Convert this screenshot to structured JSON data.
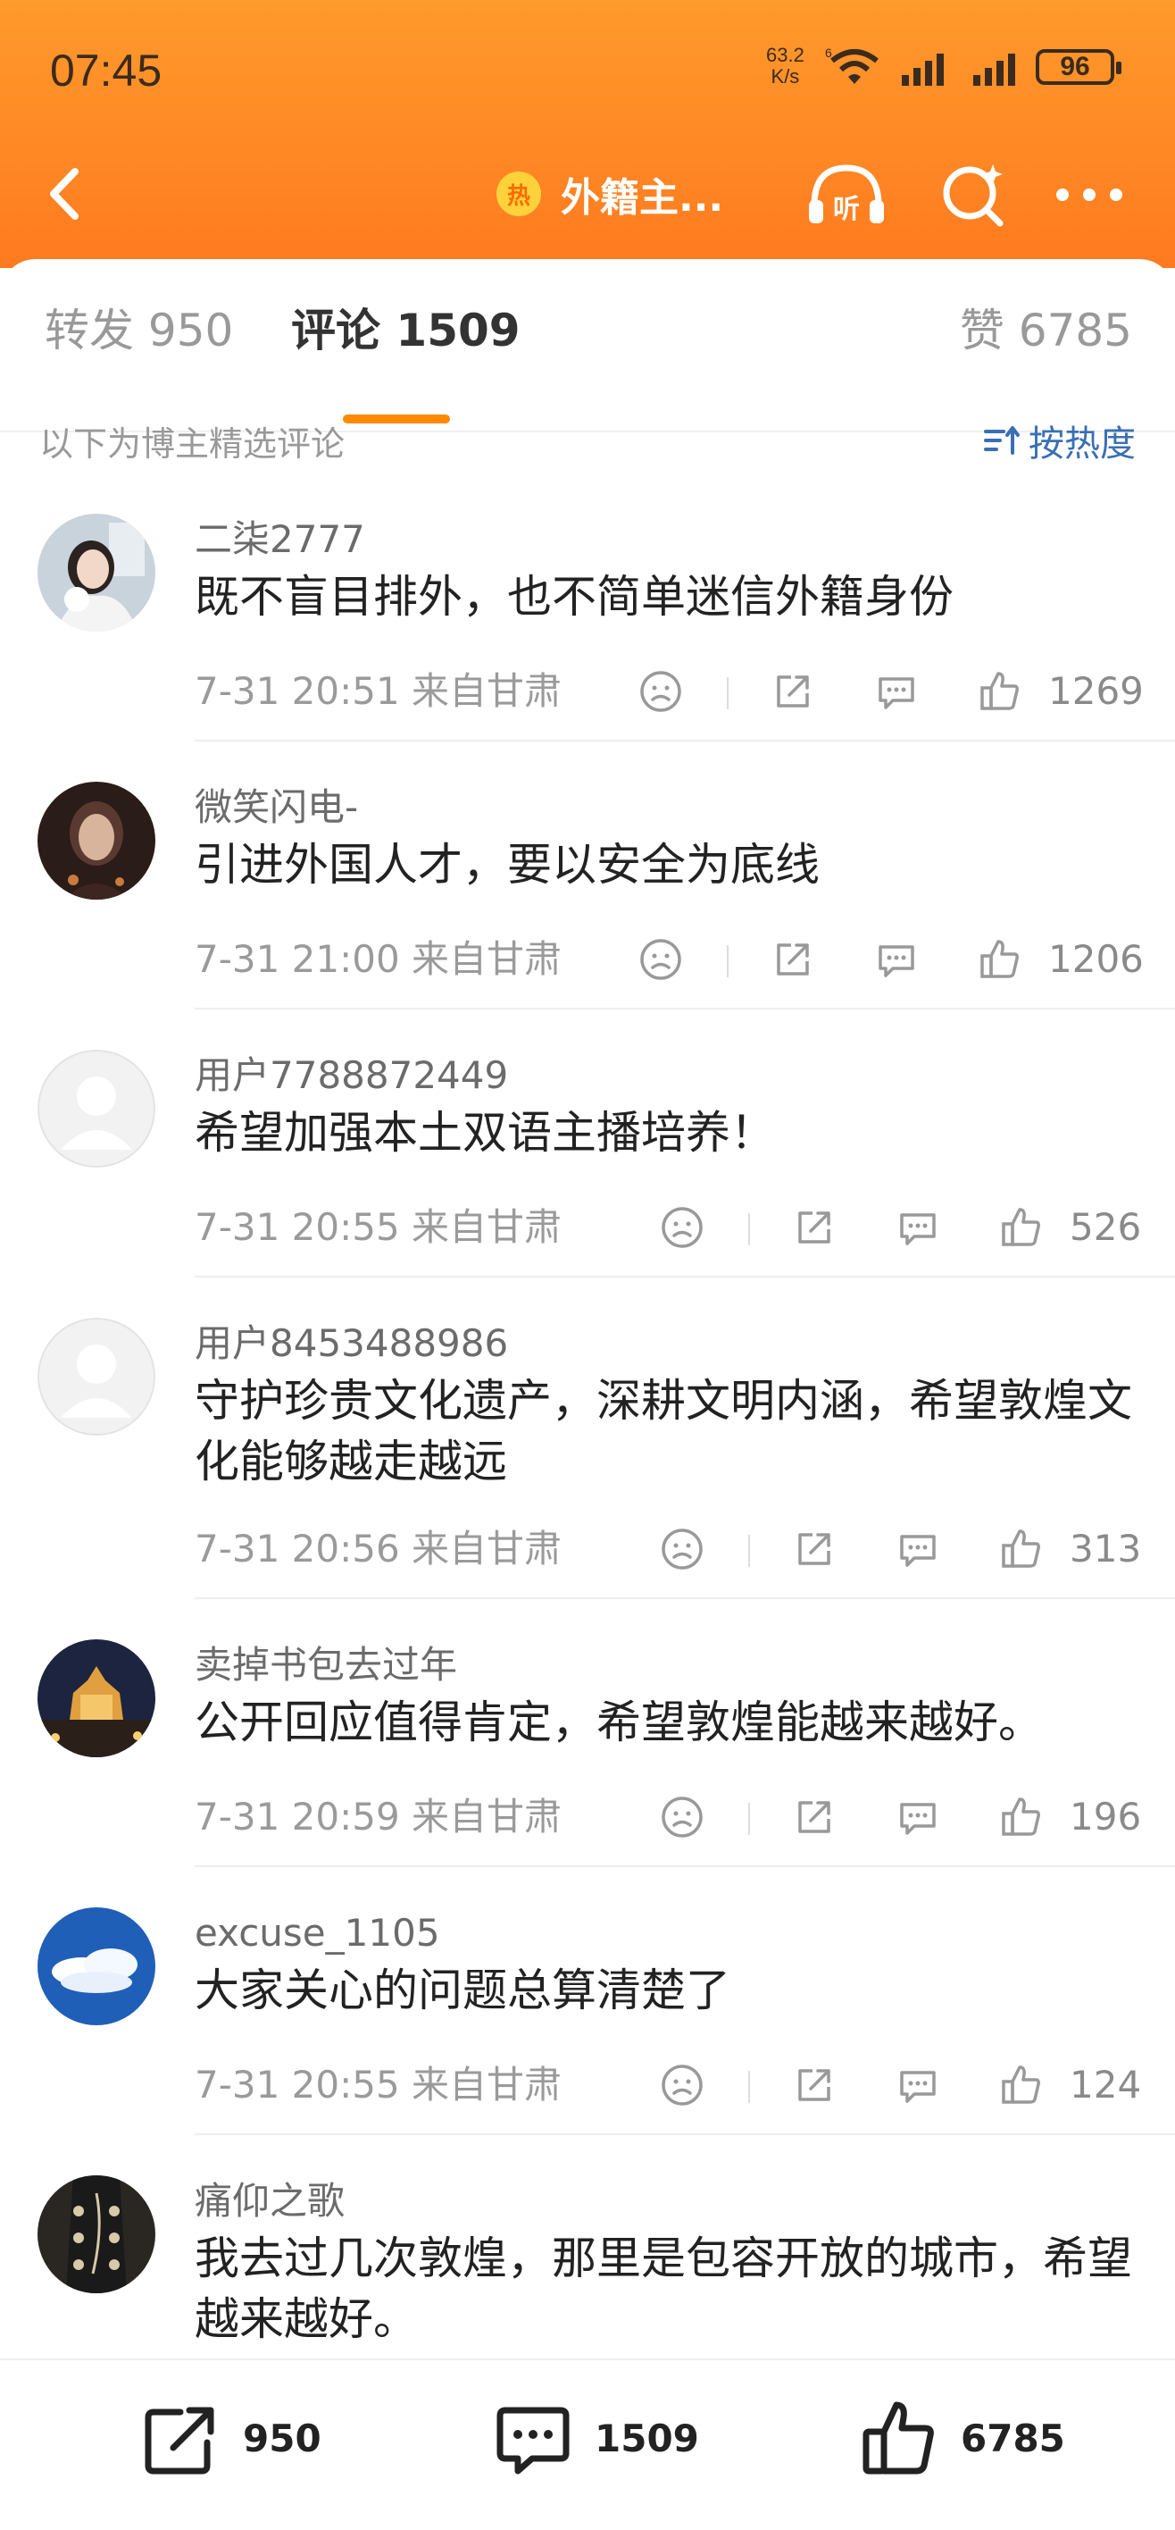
{
  "status_bar": {
    "time": "07:45",
    "net_speed_top": "63.2",
    "net_speed_bottom": "K/s",
    "battery": "96"
  },
  "nav": {
    "hot_badge": "热",
    "title": "外籍主...",
    "listen_icon_text": "听"
  },
  "tabs": {
    "repost": "转发 950",
    "comment": "评论 1509",
    "like": "赞 6785"
  },
  "filter": {
    "note": "以下为博主精选评论",
    "sort_label": "按热度"
  },
  "comments": [
    {
      "username": "二柒2777",
      "text": "既不盲目排外，也不简单迷信外籍身份",
      "time": "7-31 20:51  来自甘肃",
      "likes": "1269",
      "avatar": "girl-with-dog"
    },
    {
      "username": "微笑闪电-",
      "text": "引进外国人才，要以安全为底线",
      "time": "7-31 21:00  来自甘肃",
      "likes": "1206",
      "avatar": "dark-portrait"
    },
    {
      "username": "用户7788872449",
      "text": "希望加强本土双语主播培养！",
      "time": "7-31 20:55  来自甘肃",
      "likes": "526",
      "avatar": "default"
    },
    {
      "username": "用户8453488986",
      "text": "守护珍贵文化遗产，深耕文明内涵，希望敦煌文化能够越走越远",
      "time": "7-31 20:56  来自甘肃",
      "likes": "313",
      "avatar": "default"
    },
    {
      "username": "卖掉书包去过年",
      "text": "公开回应值得肯定，希望敦煌能越来越好。",
      "time": "7-31 20:59  来自甘肃",
      "likes": "196",
      "avatar": "night-tower"
    },
    {
      "username": "excuse_1105",
      "text": "大家关心的问题总算清楚了",
      "time": "7-31 20:55  来自甘肃",
      "likes": "124",
      "avatar": "blue-sky"
    },
    {
      "username": "痛仰之歌",
      "text": "我去过几次敦煌，那里是包容开放的城市，希望越来越好。",
      "time": "",
      "likes": "",
      "avatar": "guitar"
    }
  ],
  "bottom_bar": {
    "repost_count": "950",
    "comment_count": "1509",
    "like_count": "6785"
  },
  "colors": {
    "header_orange": "#ff8a24",
    "accent": "#ff8a00",
    "link_blue": "#3a6fb4"
  }
}
